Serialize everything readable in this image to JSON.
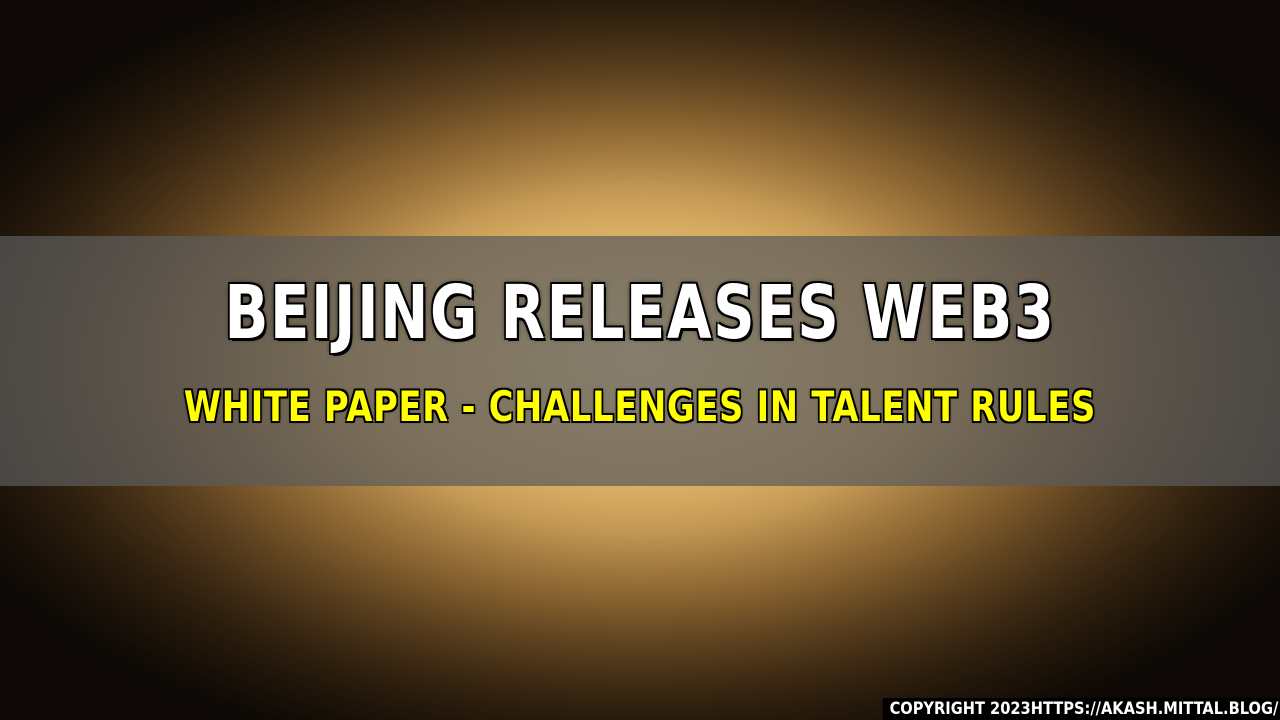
{
  "headline": "BEIJING RELEASES WEB3",
  "subheadline": "WHITE PAPER - CHALLENGES IN TALENT RULES",
  "copyright": "COPYRIGHT 2023HTTPS://AKASH.MITTAL.BLOG/",
  "colors": {
    "headline": "#ffffff",
    "subheadline": "#ffff00",
    "banner": "#5c5c5c",
    "background_gold": "#d7ac62",
    "pattern_dark": "#1b140c"
  }
}
